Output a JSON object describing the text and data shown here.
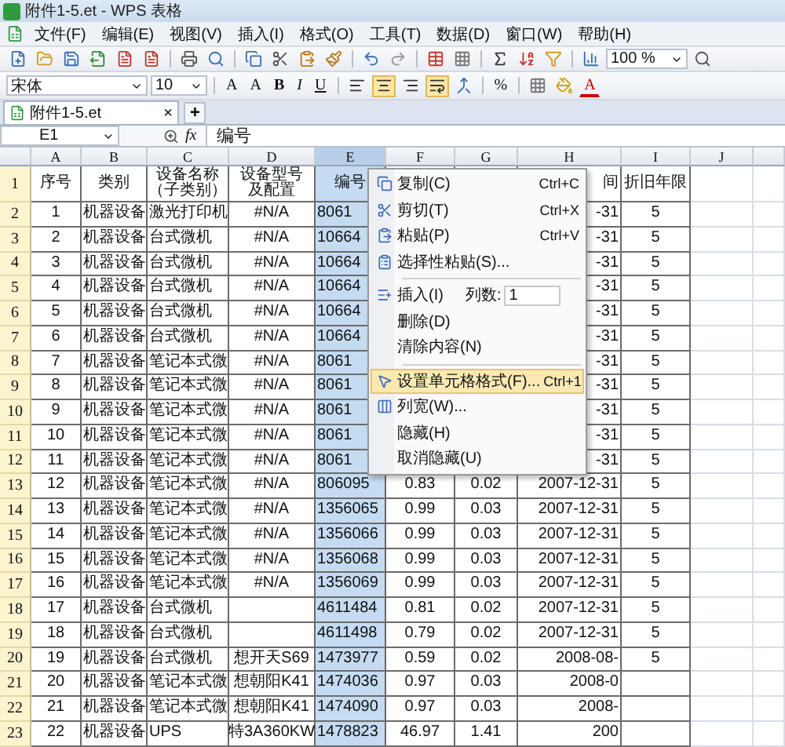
{
  "window": {
    "title": "附件1-5.et - WPS 表格"
  },
  "menu": [
    "文件(F)",
    "编辑(E)",
    "视图(V)",
    "插入(I)",
    "格式(O)",
    "工具(T)",
    "数据(D)",
    "窗口(W)",
    "帮助(H)"
  ],
  "toolbar": {
    "zoom": "100 %"
  },
  "format_bar": {
    "font": "宋体",
    "size": "10",
    "glyph_buttons": [
      "A",
      "A",
      "B",
      "I",
      "U"
    ],
    "align_buttons": [
      {
        "selected": false
      },
      {
        "selected": true
      },
      {
        "selected": false
      },
      {
        "selected": true
      }
    ],
    "percent": "%",
    "font_color": "A"
  },
  "tabs": [
    {
      "label": "附件1-5.et",
      "close": "×",
      "selected": true
    }
  ],
  "new_tab": "+",
  "formula_bar": {
    "name_box": "E1",
    "fx": "fx",
    "value": "编号"
  },
  "columns": [
    {
      "label": "A",
      "selected": false
    },
    {
      "label": "B",
      "selected": false
    },
    {
      "label": "C",
      "selected": false
    },
    {
      "label": "D",
      "selected": false
    },
    {
      "label": "E",
      "selected": true
    },
    {
      "label": "F",
      "selected": false
    },
    {
      "label": "G",
      "selected": false
    },
    {
      "label": "H",
      "selected": false
    },
    {
      "label": "I",
      "selected": false
    },
    {
      "label": "J",
      "selected": false
    }
  ],
  "rows": [
    {
      "number": "1",
      "cells": [
        "序号",
        "类别",
        [
          "设备名称",
          "（子类别）"
        ],
        [
          "设备型号",
          "及配置"
        ],
        "编号",
        "",
        "",
        "间",
        "折旧年限",
        ""
      ]
    },
    {
      "number": "2",
      "cells": [
        "1",
        "机器设备",
        "激光打印机",
        "#N/A",
        "8061",
        "",
        "",
        "-31",
        "5",
        ""
      ]
    },
    {
      "number": "3",
      "cells": [
        "2",
        "机器设备",
        "台式微机",
        "#N/A",
        "10664",
        "",
        "",
        "-31",
        "5",
        ""
      ]
    },
    {
      "number": "4",
      "cells": [
        "3",
        "机器设备",
        "台式微机",
        "#N/A",
        "10664",
        "",
        "",
        "-31",
        "5",
        ""
      ]
    },
    {
      "number": "5",
      "cells": [
        "4",
        "机器设备",
        "台式微机",
        "#N/A",
        "10664",
        "",
        "",
        "-31",
        "5",
        ""
      ]
    },
    {
      "number": "6",
      "cells": [
        "5",
        "机器设备",
        "台式微机",
        "#N/A",
        "10664",
        "",
        "",
        "-31",
        "5",
        ""
      ]
    },
    {
      "number": "7",
      "cells": [
        "6",
        "机器设备",
        "台式微机",
        "#N/A",
        "10664",
        "",
        "",
        "-31",
        "5",
        ""
      ]
    },
    {
      "number": "8",
      "cells": [
        "7",
        "机器设备",
        "笔记本式微",
        "#N/A",
        "8061",
        "",
        "",
        "-31",
        "5",
        ""
      ]
    },
    {
      "number": "9",
      "cells": [
        "8",
        "机器设备",
        "笔记本式微",
        "#N/A",
        "8061",
        "",
        "",
        "-31",
        "5",
        ""
      ]
    },
    {
      "number": "10",
      "cells": [
        "9",
        "机器设备",
        "笔记本式微",
        "#N/A",
        "8061",
        "",
        "",
        "-31",
        "5",
        ""
      ]
    },
    {
      "number": "11",
      "cells": [
        "10",
        "机器设备",
        "笔记本式微",
        "#N/A",
        "8061",
        "",
        "",
        "-31",
        "5",
        ""
      ]
    },
    {
      "number": "12",
      "cells": [
        "11",
        "机器设备",
        "笔记本式微",
        "#N/A",
        "8061",
        "",
        "",
        "-31",
        "5",
        ""
      ]
    },
    {
      "number": "13",
      "cells": [
        "12",
        "机器设备",
        "笔记本式微",
        "#N/A",
        "806095",
        "0.83",
        "0.02",
        "2007-12-31",
        "5",
        ""
      ]
    },
    {
      "number": "14",
      "cells": [
        "13",
        "机器设备",
        "笔记本式微",
        "#N/A",
        "1356065",
        "0.99",
        "0.03",
        "2007-12-31",
        "5",
        ""
      ]
    },
    {
      "number": "15",
      "cells": [
        "14",
        "机器设备",
        "笔记本式微",
        "#N/A",
        "1356066",
        "0.99",
        "0.03",
        "2007-12-31",
        "5",
        ""
      ]
    },
    {
      "number": "16",
      "cells": [
        "15",
        "机器设备",
        "笔记本式微",
        "#N/A",
        "1356068",
        "0.99",
        "0.03",
        "2007-12-31",
        "5",
        ""
      ]
    },
    {
      "number": "17",
      "cells": [
        "16",
        "机器设备",
        "笔记本式微",
        "#N/A",
        "1356069",
        "0.99",
        "0.03",
        "2007-12-31",
        "5",
        ""
      ]
    },
    {
      "number": "18",
      "cells": [
        "17",
        "机器设备",
        "台式微机",
        "",
        "4611484",
        "0.81",
        "0.02",
        "2007-12-31",
        "5",
        ""
      ]
    },
    {
      "number": "19",
      "cells": [
        "18",
        "机器设备",
        "台式微机",
        "",
        "4611498",
        "0.79",
        "0.02",
        "2007-12-31",
        "5",
        ""
      ]
    },
    {
      "number": "20",
      "cells": [
        "19",
        "机器设备",
        "台式微机",
        "想开天S69",
        "1473977",
        "0.59",
        "0.02",
        "2008-08-",
        "5",
        ""
      ]
    },
    {
      "number": "21",
      "cells": [
        "20",
        "机器设备",
        "笔记本式微",
        "想朝阳K41",
        "1474036",
        "0.97",
        "0.03",
        "2008-0",
        "",
        ""
      ]
    },
    {
      "number": "22",
      "cells": [
        "21",
        "机器设备",
        "笔记本式微",
        "想朝阳K41",
        "1474090",
        "0.97",
        "0.03",
        "2008-",
        "",
        ""
      ]
    },
    {
      "number": "23",
      "cells": [
        "22",
        "机器设备",
        "UPS",
        "特3A360KW",
        "1478823",
        "46.97",
        "1.41",
        "200",
        "",
        ""
      ]
    }
  ],
  "context_menu": [
    {
      "kind": "item",
      "label": "复制(C)",
      "shortcut": "Ctrl+C",
      "selected": false
    },
    {
      "kind": "item",
      "label": "剪切(T)",
      "shortcut": "Ctrl+X",
      "selected": false
    },
    {
      "kind": "item",
      "label": "粘贴(P)",
      "shortcut": "Ctrl+V",
      "selected": false
    },
    {
      "kind": "item",
      "label": "选择性粘贴(S)...",
      "selected": false
    },
    {
      "kind": "separator"
    },
    {
      "kind": "insert",
      "label": "插入(I)",
      "count_label": "列数:",
      "count": "1",
      "selected": false
    },
    {
      "kind": "item",
      "label": "删除(D)",
      "selected": false
    },
    {
      "kind": "item",
      "label": "清除内容(N)",
      "selected": false
    },
    {
      "kind": "separator"
    },
    {
      "kind": "item",
      "label": "设置单元格格式(F)...",
      "shortcut": "Ctrl+1",
      "selected": true
    },
    {
      "kind": "item",
      "label": "列宽(W)...",
      "selected": false
    },
    {
      "kind": "item",
      "label": "隐藏(H)",
      "selected": false
    },
    {
      "kind": "item",
      "label": "取消隐藏(U)",
      "selected": false
    }
  ]
}
